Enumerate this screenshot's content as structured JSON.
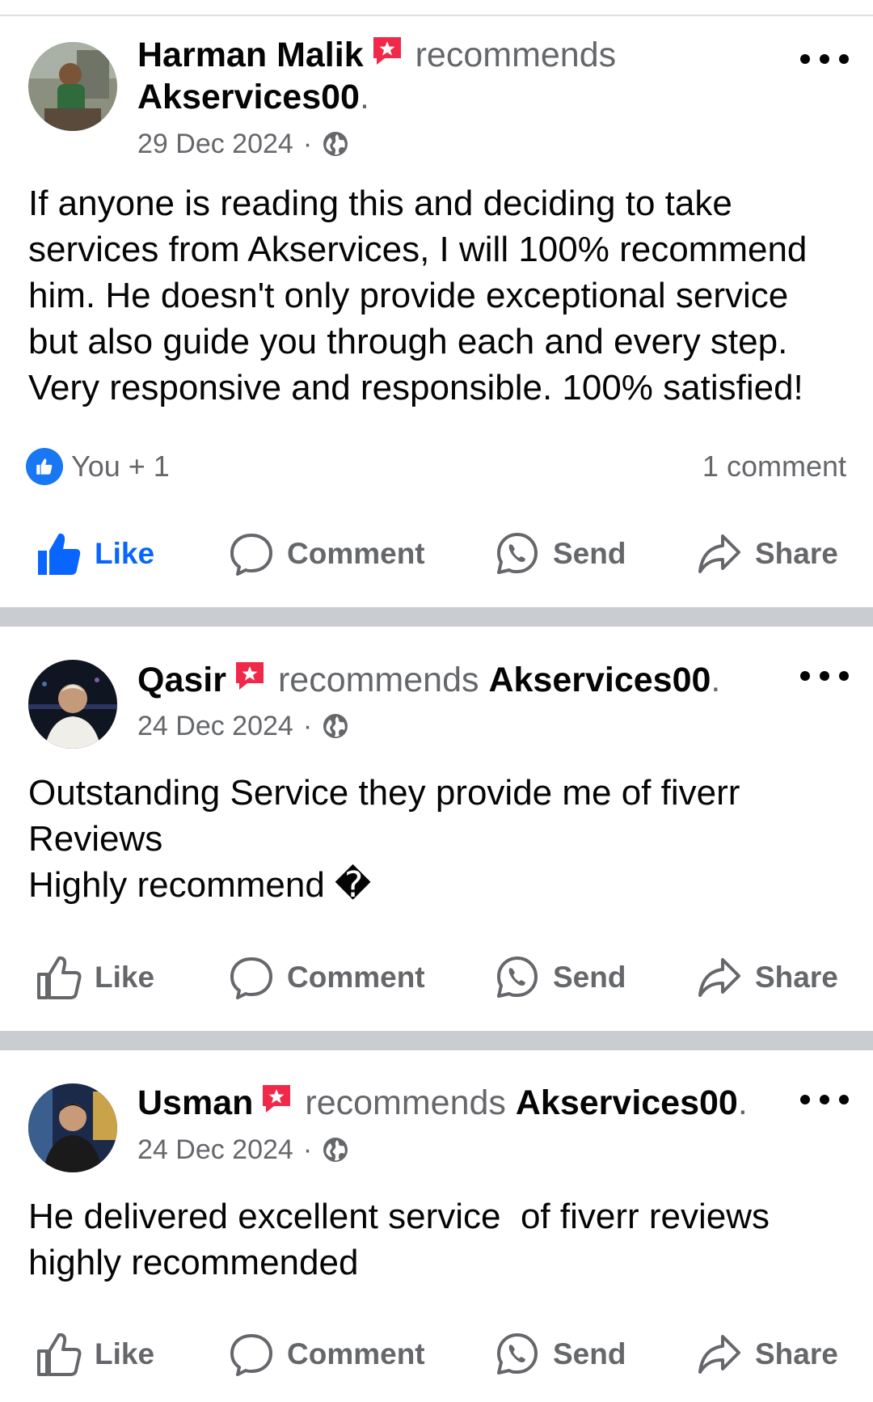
{
  "posts": [
    {
      "author": "Harman Malik",
      "verb": "recommends",
      "page": "Akservices00",
      "suffix": ".",
      "date": "29 Dec 2024",
      "separator": "·",
      "text": "If anyone is reading this and deciding to take\nservices from Akservices, I will 100% recommend\nhim. He doesn't only provide exceptional service\nbut also guide you through each and every step.\nVery responsive and responsible. 100% satisfied!",
      "reactions": "You + 1",
      "comments": "1 comment",
      "liked": true
    },
    {
      "author": "Qasir",
      "verb": "recommends",
      "page": "Akservices00",
      "suffix": ".",
      "date": "24 Dec 2024",
      "separator": "·",
      "text": "Outstanding Service they provide me of fiverr\nReviews\nHighly recommend �",
      "liked": false
    },
    {
      "author": "Usman",
      "verb": "recommends",
      "page": "Akservices00",
      "suffix": ".",
      "date": "24 Dec 2024",
      "separator": "·",
      "text": "He delivered excellent service  of fiverr reviews\nhighly recommended",
      "liked": false
    }
  ],
  "actions": {
    "like": "Like",
    "comment": "Comment",
    "send": "Send",
    "share": "Share"
  },
  "colors": {
    "like_blue": "#0866ff",
    "badge_red": "#f02849",
    "meta_gray": "#65676b",
    "divider": "#c9ccd1"
  },
  "icons": [
    "recommend-badge-icon",
    "globe-icon",
    "more-icon",
    "like-icon",
    "comment-icon",
    "send-icon",
    "share-icon"
  ]
}
